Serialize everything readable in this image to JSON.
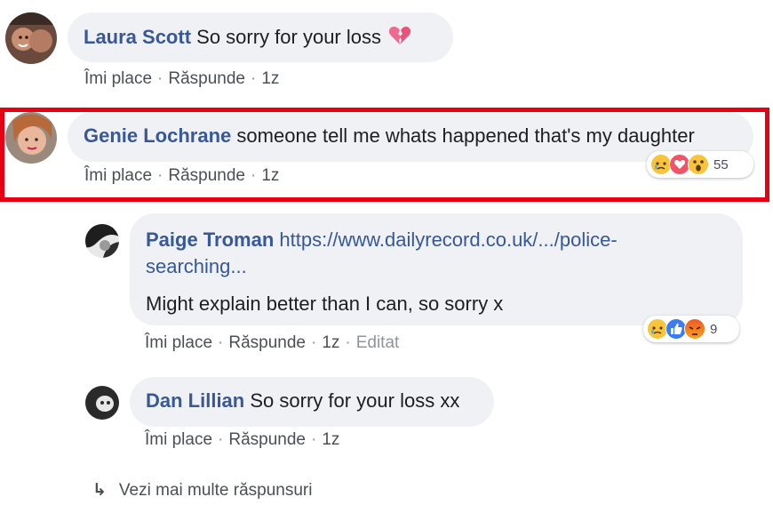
{
  "comments": [
    {
      "author": "Laura Scott",
      "text": "So sorry for your loss",
      "emoji": "broken-heart-icon",
      "actions": {
        "like": "Îmi place",
        "reply": "Răspunde",
        "time": "1z"
      }
    },
    {
      "author": "Genie Lochrane",
      "text": "someone tell me whats happened that's my daughter",
      "actions": {
        "like": "Îmi place",
        "reply": "Răspunde",
        "time": "1z"
      },
      "reactions": {
        "types": [
          "sad",
          "love",
          "wow"
        ],
        "count": "55"
      }
    }
  ],
  "replies": [
    {
      "author": "Paige Troman",
      "link_part1": "https://www.dailyrecord.co.uk/.../police-",
      "link_part2": "searching...",
      "text": "Might explain better than I can, so sorry x",
      "actions": {
        "like": "Îmi place",
        "reply": "Răspunde",
        "time": "1z",
        "edited": "Editat"
      },
      "reactions": {
        "types": [
          "sad",
          "like",
          "angry"
        ],
        "count": "9"
      }
    },
    {
      "author": "Dan Lillian",
      "text": "So sorry for your loss xx",
      "actions": {
        "like": "Îmi place",
        "reply": "Răspunde",
        "time": "1z"
      }
    }
  ],
  "more_replies": "Vezi mai multe răspunsuri",
  "colors": {
    "name": "#385898",
    "bubble": "#eff1f4",
    "highlight": "#e60012"
  }
}
